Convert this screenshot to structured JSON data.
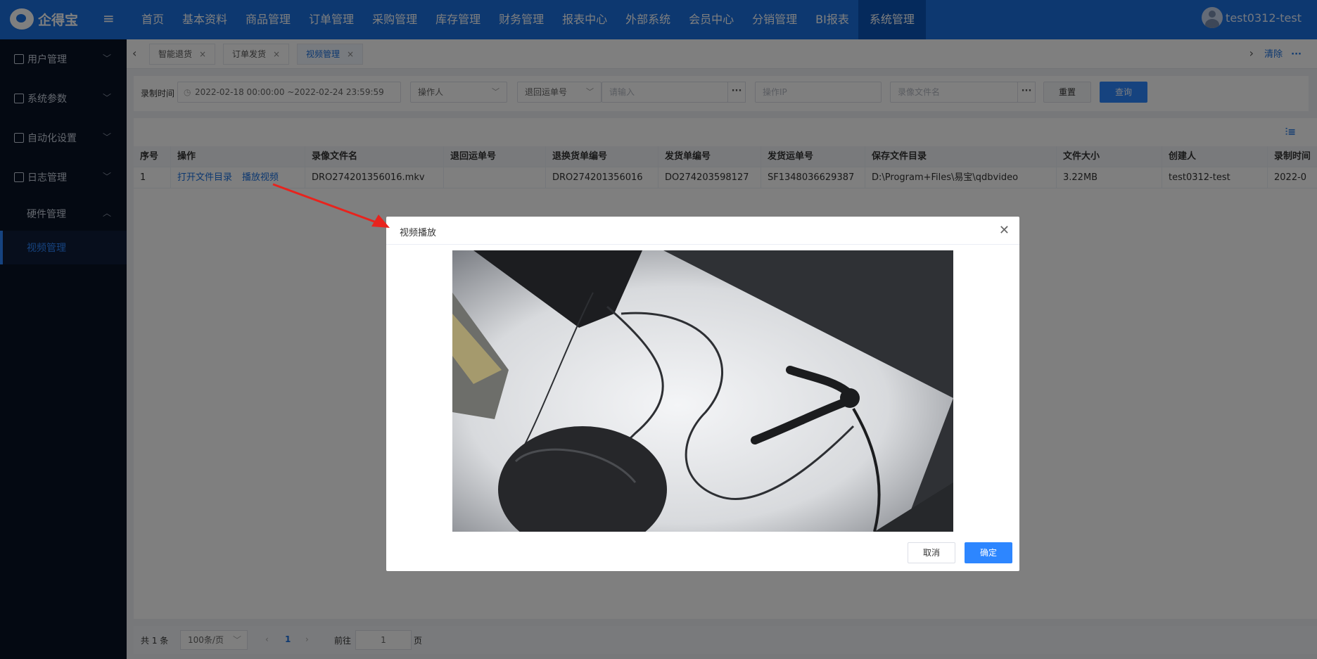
{
  "app": {
    "name": "企得宝"
  },
  "nav": [
    "首页",
    "基本资料",
    "商品管理",
    "订单管理",
    "采购管理",
    "库存管理",
    "财务管理",
    "报表中心",
    "外部系统",
    "会员中心",
    "分销管理",
    "BI报表",
    "系统管理"
  ],
  "user": "test0312-test",
  "sidebar": {
    "items": [
      {
        "label": "用户管理",
        "icon": "user-icon"
      },
      {
        "label": "系统参数",
        "icon": "monitor-icon"
      },
      {
        "label": "自动化设置",
        "icon": "document-icon"
      },
      {
        "label": "日志管理",
        "icon": "calendar-icon"
      }
    ],
    "sub": [
      {
        "label": "硬件管理"
      },
      {
        "label": "视频管理"
      }
    ]
  },
  "tabs": [
    "智能退货",
    "订单发货",
    "视频管理"
  ],
  "tabs_right": {
    "clear": "清除",
    "more": "···"
  },
  "filter": {
    "time_label": "录制时间",
    "time_value": "2022-02-18 00:00:00 ~2022-02-24 23:59:59",
    "operator": "操作人",
    "return_no": "退回运单号",
    "input_placeholder": "请输入",
    "ip_placeholder": "操作IP",
    "file_placeholder": "录像文件名",
    "reset": "重置",
    "search": "查询"
  },
  "table": {
    "headers": [
      "序号",
      "操作",
      "录像文件名",
      "退回运单号",
      "退换货单编号",
      "发货单编号",
      "发货运单号",
      "保存文件目录",
      "文件大小",
      "创建人",
      "录制时间"
    ],
    "rows": [
      {
        "index": "1",
        "op_open": "打开文件目录",
        "op_play": "播放视频",
        "file": "DRO274201356016.mkv",
        "return_no": "",
        "exchange_no": "DRO274201356016",
        "ship_no": "DO274203598127",
        "ship_waybill": "SF1348036629387",
        "dir": "D:\\Program+Files\\易宝\\qdbvideo",
        "size": "3.22MB",
        "creator": "test0312-test",
        "time": "2022-0"
      }
    ]
  },
  "pager": {
    "total": "共 1 条",
    "size": "100条/页",
    "page": "1",
    "goto": "前往",
    "goto_value": "1",
    "unit": "页"
  },
  "modal": {
    "title": "视频播放",
    "cancel": "取消",
    "ok": "确定"
  },
  "colors": {
    "primary": "#1a70e0",
    "sidebar": "#081224",
    "annotation": "#e8231d"
  }
}
